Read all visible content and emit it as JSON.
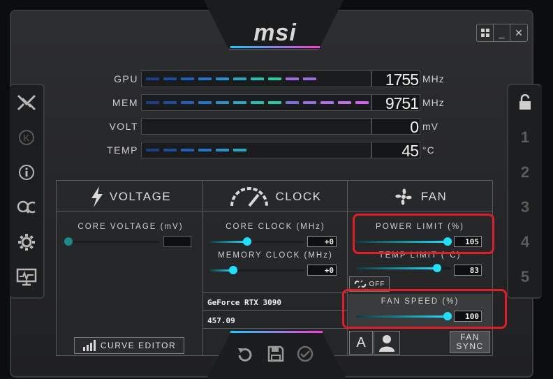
{
  "brand": "msi",
  "window_controls": {
    "windows_icon": "windows-icon",
    "minimize": "_",
    "close": "✕"
  },
  "left_sidebar": [
    {
      "icon": "kombustor-icon",
      "glyph": "✗"
    },
    {
      "icon": "k-icon",
      "glyph": "Ⓚ"
    },
    {
      "icon": "info-icon",
      "glyph": "ⓘ"
    },
    {
      "icon": "oc-scanner-icon",
      "glyph": "OC"
    },
    {
      "icon": "settings-gear-icon",
      "glyph": "⚙"
    },
    {
      "icon": "monitor-icon",
      "glyph": "▭"
    }
  ],
  "profiles": [
    "1",
    "2",
    "3",
    "4",
    "5"
  ],
  "monitor": {
    "gpu": {
      "label": "GPU",
      "value": "1755",
      "unit": "MHz",
      "fill_fraction": 0.7
    },
    "mem": {
      "label": "MEM",
      "value": "9751",
      "unit": "MHz",
      "fill_fraction": 1.0
    },
    "volt": {
      "label": "VOLT",
      "value": "0",
      "unit": "mV",
      "fill_fraction": 0.0
    },
    "temp": {
      "label": "TEMP",
      "value": "45",
      "unit": "°C",
      "fill_fraction": 0.45
    }
  },
  "voltage": {
    "title": "VOLTAGE",
    "core_voltage_label": "CORE VOLTAGE  (mV)",
    "core_voltage_value": "",
    "slider_fraction": 0.0,
    "curve_editor_label": "CURVE EDITOR"
  },
  "clock": {
    "title": "CLOCK",
    "core_clock_label": "CORE CLOCK (MHz)",
    "core_clock_value": "+0",
    "core_clock_fraction": 0.4,
    "memory_clock_label": "MEMORY CLOCK (MHz)",
    "memory_clock_value": "+0",
    "memory_clock_fraction": 0.25,
    "gpu_name": "GeForce RTX 3090",
    "driver_version": "457.09"
  },
  "fan": {
    "title": "FAN",
    "power_limit_label": "POWER LIMIT (%)",
    "power_limit_value": "105",
    "power_limit_fraction": 0.96,
    "temp_limit_label": "TEMP LIMIT (°C)",
    "temp_limit_value": "83",
    "temp_limit_fraction": 0.85,
    "link_state": "OFF",
    "fan_speed_label": "FAN SPEED (%)",
    "fan_speed_value": "100",
    "fan_speed_fraction": 0.96,
    "auto_label": "A",
    "fan_sync_label": "FAN SYNC"
  },
  "colors": {
    "accent_cyan": "#1fe0ff",
    "highlight_red": "#e11d2a",
    "mem_magenta": "#ff2ad6"
  }
}
